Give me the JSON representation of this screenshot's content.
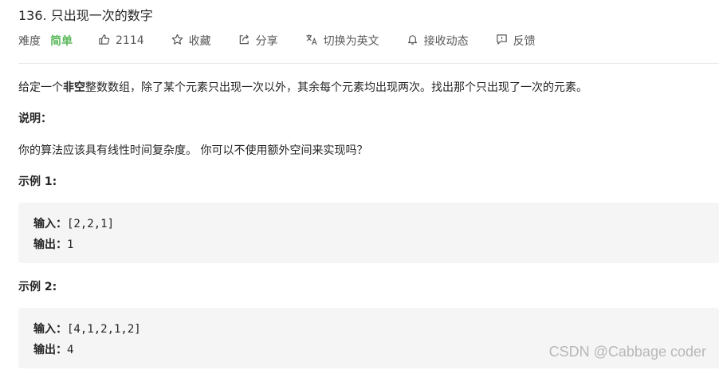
{
  "problem": {
    "title": "136. 只出现一次的数字",
    "difficulty_label": "难度",
    "difficulty": "简单",
    "colors": {
      "difficulty": "#5cb85c",
      "text": "#262626",
      "muted": "#595959",
      "example_bg": "#f5f5f5"
    }
  },
  "toolbar": {
    "like": {
      "icon": "thumbs-up-icon",
      "label": "2114"
    },
    "favorite": {
      "icon": "star-icon",
      "label": "收藏"
    },
    "share": {
      "icon": "share-icon",
      "label": "分享"
    },
    "translate": {
      "icon": "translate-icon",
      "label": "切换为英文"
    },
    "subscribe": {
      "icon": "bell-icon",
      "label": "接收动态"
    },
    "feedback": {
      "icon": "feedback-icon",
      "label": "反馈"
    }
  },
  "description": {
    "p1_a": "给定一个",
    "p1_b": "非空",
    "p1_c": "整数数组，除了某个元素只出现一次以外，其余每个元素均出现两次。找出那个只出现了一次的元素。",
    "note_title": "说明：",
    "note_text": "你的算法应该具有线性时间复杂度。 你可以不使用额外空间来实现吗？"
  },
  "examples": [
    {
      "title": "示例 1:",
      "input_label": "输入：",
      "input": "[2,2,1]",
      "output_label": "输出：",
      "output": "1"
    },
    {
      "title": "示例 2:",
      "input_label": "输入：",
      "input": "[4,1,2,1,2]",
      "output_label": "输出：",
      "output": "4"
    }
  ],
  "watermark": "CSDN @Cabbage coder"
}
